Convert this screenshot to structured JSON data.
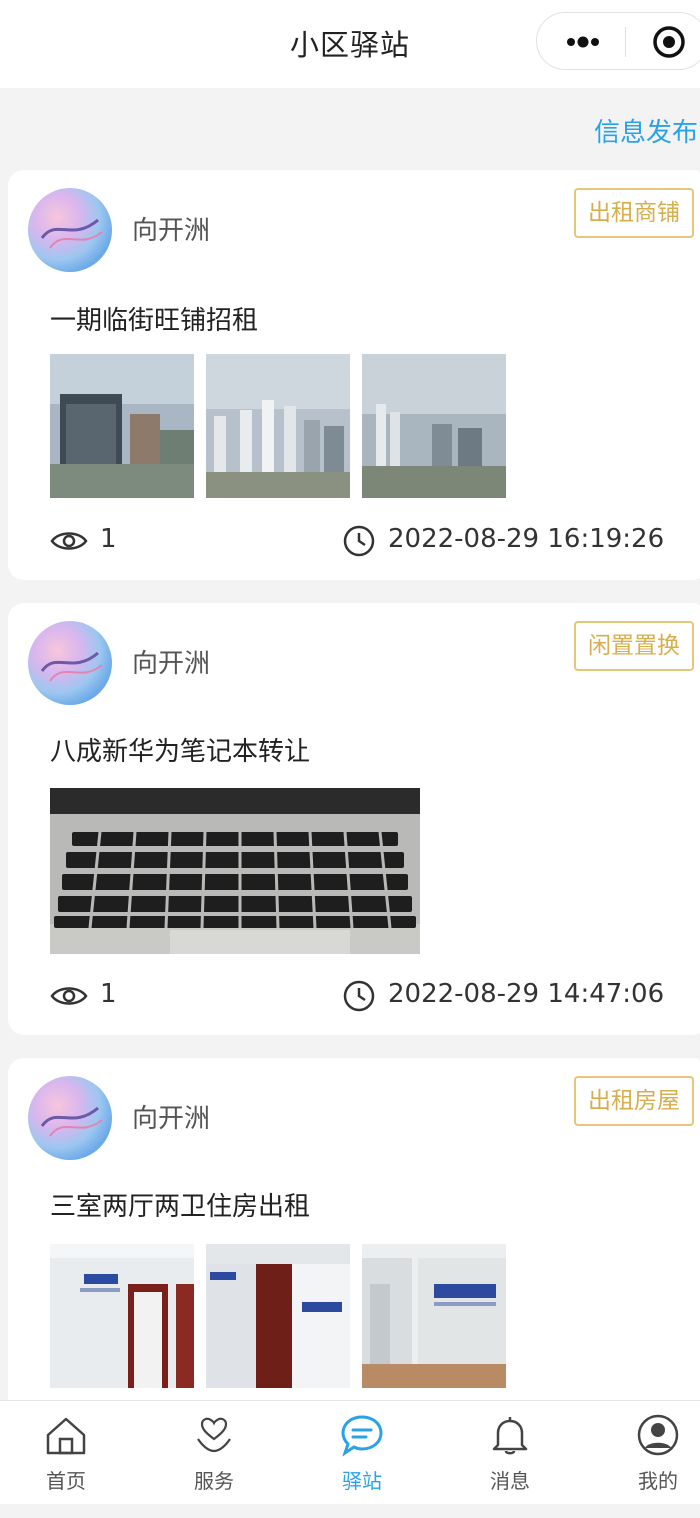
{
  "header": {
    "title": "小区驿站"
  },
  "publish_label": "信息发布",
  "posts": [
    {
      "author": "向开洲",
      "tag": "出租商铺",
      "title": "一期临街旺铺招租",
      "views": "1",
      "time": "2022-08-29 16:19:26"
    },
    {
      "author": "向开洲",
      "tag": "闲置置换",
      "title": "八成新华为笔记本转让",
      "views": "1",
      "time": "2022-08-29 14:47:06"
    },
    {
      "author": "向开洲",
      "tag": "出租房屋",
      "title": "三室两厅两卫住房出租"
    }
  ],
  "tabs": [
    {
      "label": "首页",
      "icon": "home-icon"
    },
    {
      "label": "服务",
      "icon": "heart-hand-icon"
    },
    {
      "label": "驿站",
      "icon": "chat-bubble-icon",
      "active": true
    },
    {
      "label": "消息",
      "icon": "bell-icon"
    },
    {
      "label": "我的",
      "icon": "user-icon"
    }
  ],
  "colors": {
    "accent": "#2aa3e6",
    "tag_border": "#e6c77a",
    "tag_text": "#d7ae4c",
    "background": "#f3f3f3"
  }
}
